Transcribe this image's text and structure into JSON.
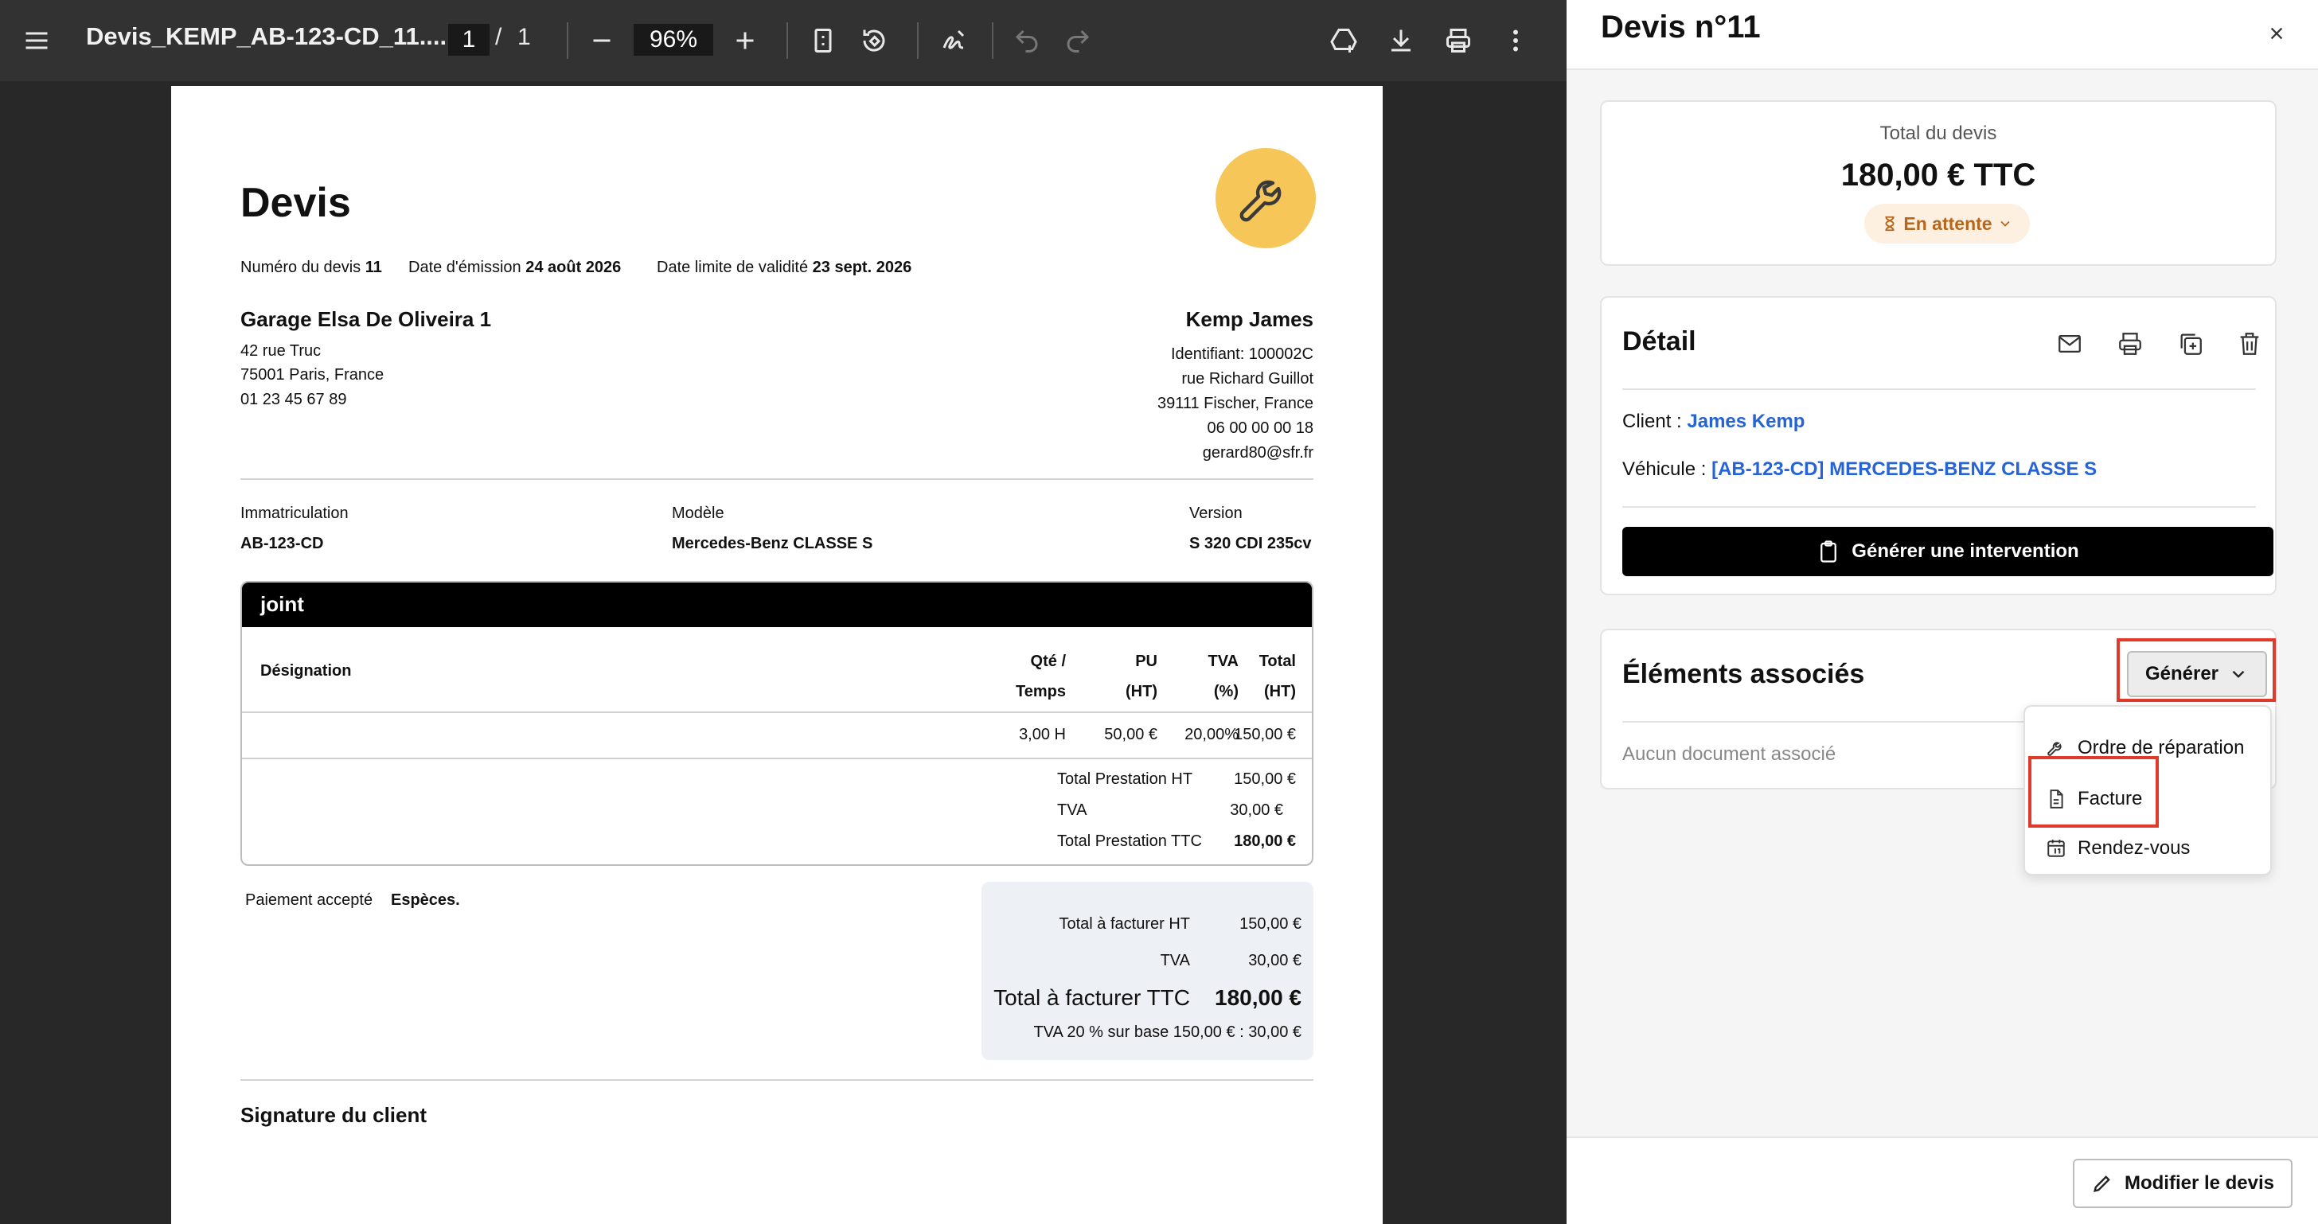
{
  "viewer": {
    "file_name": "Devis_KEMP_AB-123-CD_11....",
    "current_page": "1",
    "page_separator": "/",
    "total_pages": "1",
    "zoom": "96%"
  },
  "doc": {
    "title": "Devis",
    "meta": {
      "number_label": "Numéro du devis",
      "number_value": "11",
      "issue_label": "Date d'émission",
      "issue_value": "24 août 2026",
      "validity_label": "Date limite de validité",
      "validity_value": "23 sept. 2026"
    },
    "garage": {
      "name": "Garage Elsa De Oliveira 1",
      "street": "42 rue Truc",
      "city": "75001 Paris, France",
      "phone": "01 23 45 67 89"
    },
    "client": {
      "name": "Kemp James",
      "id": "Identifiant: 100002C",
      "street": "rue Richard Guillot",
      "city": "39111 Fischer, France",
      "phone": "06 00 00 00 18",
      "email": "gerard80@sfr.fr"
    },
    "vehicle": {
      "plate_label": "Immatriculation",
      "plate_value": "AB-123-CD",
      "model_label": "Modèle",
      "model_value": "Mercedes-Benz CLASSE S",
      "version_label": "Version",
      "version_value": "S 320 CDI 235cv"
    },
    "section": {
      "title": "joint",
      "headers": {
        "designation": "Désignation",
        "qty_1": "Qté /",
        "qty_2": "Temps",
        "pu_1": "PU",
        "pu_2": "(HT)",
        "tva_1": "TVA",
        "tva_2": "(%)",
        "total_1": "Total",
        "total_2": "(HT)"
      },
      "row": {
        "qty": "3,00 H",
        "pu": "50,00 €",
        "tva": "20,00%",
        "total": "150,00 €"
      },
      "subtotals": [
        {
          "label": "Total Prestation HT",
          "value": "150,00 €"
        },
        {
          "label": "TVA",
          "value": "30,00 €"
        },
        {
          "label": "Total Prestation TTC",
          "value": "180,00 €"
        }
      ]
    },
    "payment": {
      "label": "Paiement accepté",
      "value": "Espèces."
    },
    "totals": {
      "ht_label": "Total à facturer HT",
      "ht_value": "150,00 €",
      "tva_label": "TVA",
      "tva_value": "30,00 €",
      "ttc_label": "Total à facturer TTC",
      "ttc_value": "180,00 €",
      "vat_note": "TVA 20 % sur base 150,00 € : 30,00 €"
    },
    "signature": "Signature du client"
  },
  "panel": {
    "title": "Devis n°11",
    "summary": {
      "label": "Total du devis",
      "amount": "180,00 € TTC",
      "status": "En attente"
    },
    "detail": {
      "title": "Détail",
      "client_label": "Client :",
      "client_value": "James Kemp",
      "vehicle_label": "Véhicule :",
      "vehicle_value": "[AB-123-CD] MERCEDES-BENZ CLASSE S",
      "generate_intervention": "Générer une intervention"
    },
    "associated": {
      "title": "Éléments associés",
      "generate_button": "Générer",
      "empty_text": "Aucun document associé",
      "menu": [
        {
          "label": "Ordre de réparation",
          "icon": "wrench-icon"
        },
        {
          "label": "Facture",
          "icon": "document-icon"
        },
        {
          "label": "Rendez-vous",
          "icon": "calendar-icon"
        }
      ]
    },
    "edit_button": "Modifier le devis"
  },
  "colors": {
    "accent_logo": "#f6c659",
    "status_bg": "#fdf0e0",
    "status_text": "#b8651d",
    "link_blue": "#2563d6",
    "highlight_red": "#e03a2b"
  }
}
